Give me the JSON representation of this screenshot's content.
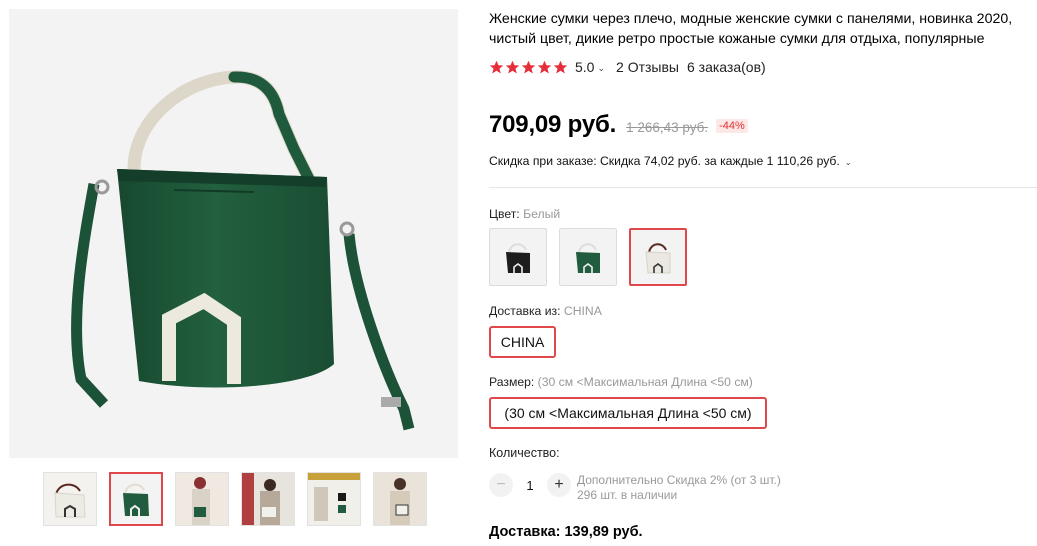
{
  "product": {
    "title": "Женские сумки через плечо, модные женские сумки с панелями, новинка 2020, чистый цвет, дикие ретро простые кожаные сумки для отдыха, популярные",
    "rating": "5.0",
    "reviews": "2 Отзывы",
    "orders": "6 заказа(ов)",
    "stars_filled": 5
  },
  "price": {
    "current": "709,09 руб.",
    "original": "1 266,43 руб.",
    "discount": "-44%"
  },
  "promo": {
    "text": "Скидка при заказе: Скидка 74,02 руб. за каждые 1 110,26 руб."
  },
  "color": {
    "label": "Цвет:",
    "selected": "Белый",
    "options": [
      "black",
      "green",
      "white"
    ],
    "selected_index": 2
  },
  "ship_from": {
    "label": "Доставка из:",
    "selected": "CHINA",
    "option": "CHINA"
  },
  "size": {
    "label": "Размер:",
    "selected": "(30 см <Максимальная Длина <50 см)",
    "option": "(30 см <Максимальная Длина <50 см)"
  },
  "quantity": {
    "label": "Количество:",
    "value": "1",
    "extra_discount": "Дополнительно Скидка 2% (от 3 шт.)",
    "stock": "296 шт. в наличии"
  },
  "delivery": {
    "text": "Доставка: 139,89 руб."
  },
  "gallery": {
    "selected_index": 1,
    "thumb_count": 6
  },
  "colors": {
    "accent": "#e0474b",
    "star": "#e62e3c",
    "bag_green": "#1f5a3d",
    "strap_cream": "#e8e4d6"
  }
}
